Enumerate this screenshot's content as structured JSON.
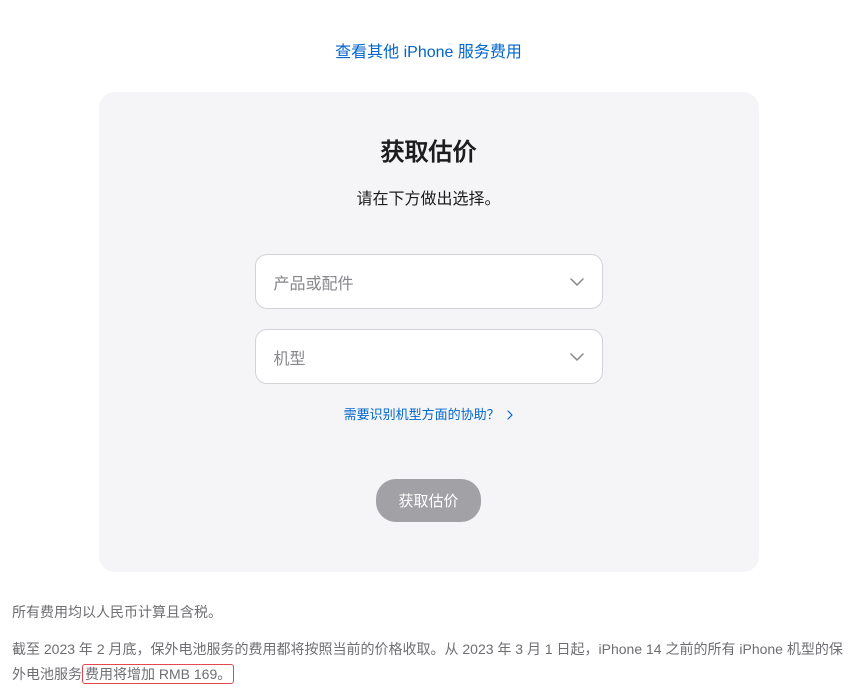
{
  "topLink": {
    "label": "查看其他 iPhone 服务费用"
  },
  "card": {
    "title": "获取估价",
    "subtitle": "请在下方做出选择。",
    "select1": {
      "placeholder": "产品或配件"
    },
    "select2": {
      "placeholder": "机型"
    },
    "helpLink": {
      "label": "需要识别机型方面的协助？"
    },
    "submitButton": {
      "label": "获取估价"
    }
  },
  "footer": {
    "line1": "所有费用均以人民币计算且含税。",
    "line2_part1": "截至 2023 年 2 月底，保外电池服务的费用都将按照当前的价格收取。从 2023 年 3 月 1 日起，iPhone 14 之前的所有 iPhone 机型的保外电池服务",
    "line2_part2": "费用将增加 RMB 169。"
  }
}
